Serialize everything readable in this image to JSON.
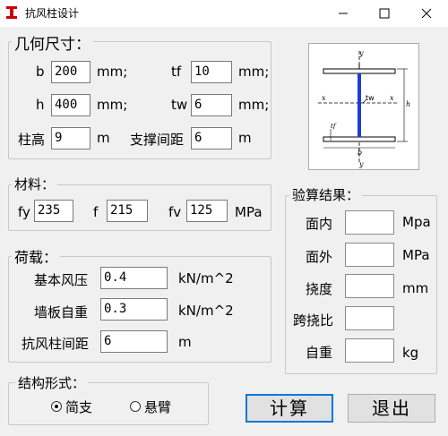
{
  "window": {
    "title": "抗风柱设计"
  },
  "geometry": {
    "legend": "几何尺寸：",
    "b": {
      "label": "b",
      "value": "200",
      "unit": "mm;"
    },
    "h": {
      "label": "h",
      "value": "400",
      "unit": "mm;"
    },
    "tf": {
      "label": "tf",
      "value": "10",
      "unit": "mm;"
    },
    "tw": {
      "label": "tw",
      "value": "6",
      "unit": "mm;"
    },
    "col_height": {
      "label": "柱高",
      "value": "9",
      "unit": "m"
    },
    "brace_spacing": {
      "label": "支撑间距",
      "value": "6",
      "unit": "m"
    }
  },
  "diagram": {
    "y_top": "y",
    "y_bottom": "y",
    "x_left": "x",
    "x_right": "x",
    "tw": "tw",
    "tf": "tf",
    "h": "h",
    "b": "b"
  },
  "material": {
    "legend": "材料：",
    "fy": {
      "label": "fy",
      "value": "235"
    },
    "f": {
      "label": "f",
      "value": "215"
    },
    "fv": {
      "label": "fv",
      "value": "125"
    },
    "unit": "MPa"
  },
  "loads": {
    "legend": "荷载：",
    "wind_pressure": {
      "label": "基本风压",
      "value": "0.4",
      "unit": "kN/m^2"
    },
    "wall_weight": {
      "label": "墙板自重",
      "value": "0.3",
      "unit": "kN/m^2"
    },
    "col_spacing": {
      "label": "抗风柱间距",
      "value": "6",
      "unit": "m"
    }
  },
  "results": {
    "legend": "验算结果：",
    "in_plane": {
      "label": "面内",
      "value": "",
      "unit": "Mpa"
    },
    "out_plane": {
      "label": "面外",
      "value": "",
      "unit": "MPa"
    },
    "deflection": {
      "label": "挠度",
      "value": "",
      "unit": "mm"
    },
    "span_ratio": {
      "label": "跨挠比",
      "value": ""
    },
    "self_weight": {
      "label": "自重",
      "value": "",
      "unit": "kg"
    }
  },
  "structure": {
    "legend": "结构形式：",
    "options": [
      {
        "label": "简支",
        "selected": true
      },
      {
        "label": "悬臂",
        "selected": false
      }
    ]
  },
  "buttons": {
    "calc": "计算",
    "exit": "退出"
  },
  "colors": {
    "accent": "#0078d7",
    "section_fill": "#1a3fd6"
  }
}
